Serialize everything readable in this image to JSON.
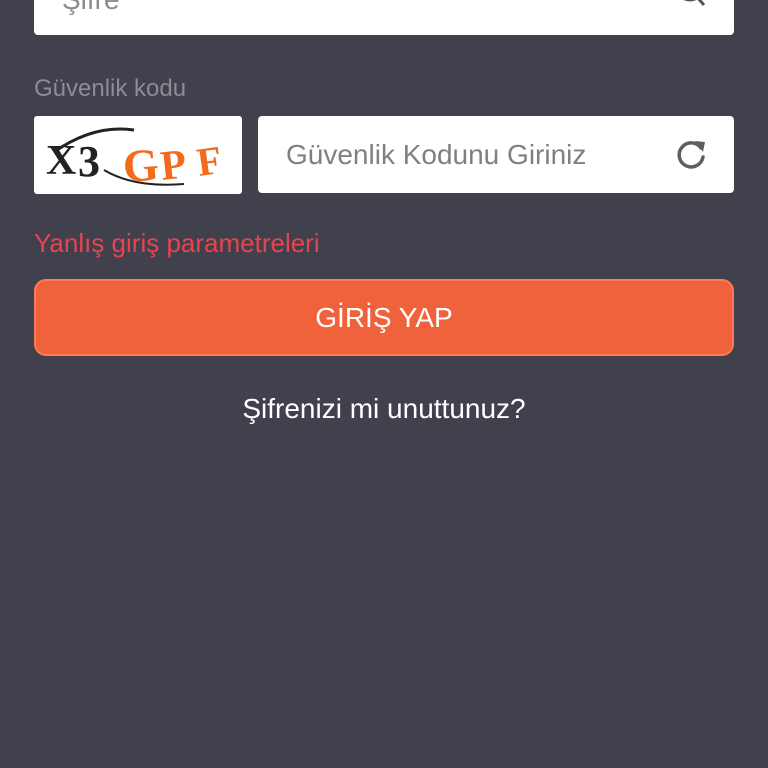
{
  "password": {
    "placeholder": "Şifre"
  },
  "security": {
    "label": "Güvenlik kodu",
    "captcha_text": "X3GPF",
    "input_placeholder": "Güvenlik Kodunu Giriniz"
  },
  "error": {
    "message": "Yanlış giriş parametreleri"
  },
  "login_button": {
    "label": "GİRİŞ YAP"
  },
  "forgot_password": {
    "label": "Şifrenizi mi unuttunuz?"
  },
  "icons": {
    "password_toggle": "eye-icon",
    "captcha_refresh": "refresh-icon"
  },
  "colors": {
    "background": "#41404d",
    "accent": "#f0623c",
    "error": "#e8444f",
    "label": "#8d8c96"
  }
}
